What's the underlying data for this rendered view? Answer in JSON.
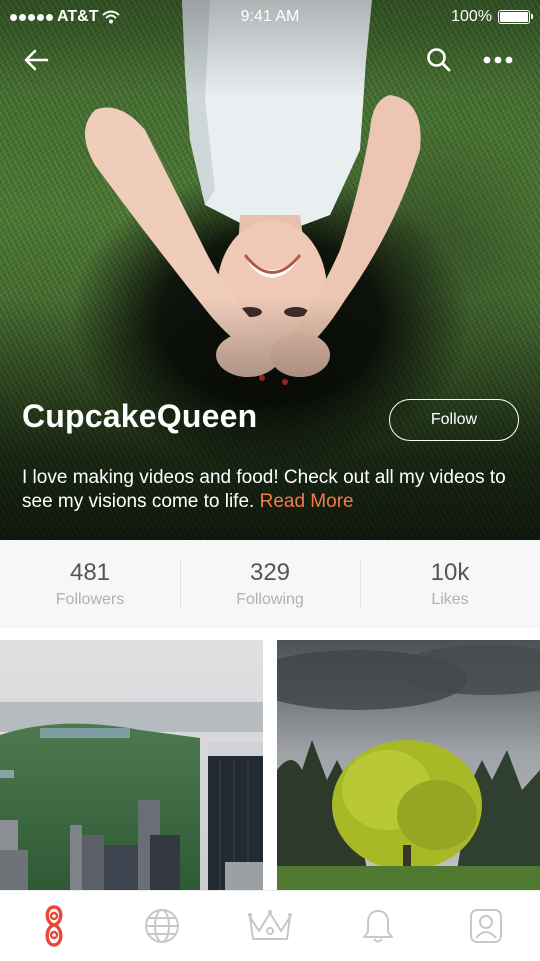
{
  "status_bar": {
    "carrier": "AT&T",
    "time": "9:41 AM",
    "battery": "100%"
  },
  "profile": {
    "username": "CupcakeQueen",
    "follow_label": "Follow",
    "bio": "I love making videos and food! Check out all my videos to see my visions come to life.",
    "read_more": "Read More"
  },
  "stats": [
    {
      "value": "481",
      "label": "Followers"
    },
    {
      "value": "329",
      "label": "Following"
    },
    {
      "value": "10k",
      "label": "Likes"
    }
  ],
  "tabs": [
    {
      "icon": "home-logo-icon",
      "active": true
    },
    {
      "icon": "globe-icon",
      "active": false
    },
    {
      "icon": "crown-icon",
      "active": false
    },
    {
      "icon": "bell-icon",
      "active": false
    },
    {
      "icon": "profile-icon",
      "active": false
    }
  ],
  "colors": {
    "accent": "#f47a4d",
    "active_tab": "#e8473a",
    "inactive_tab": "#c8c8c8",
    "stats_background": "#f7f7f7"
  }
}
